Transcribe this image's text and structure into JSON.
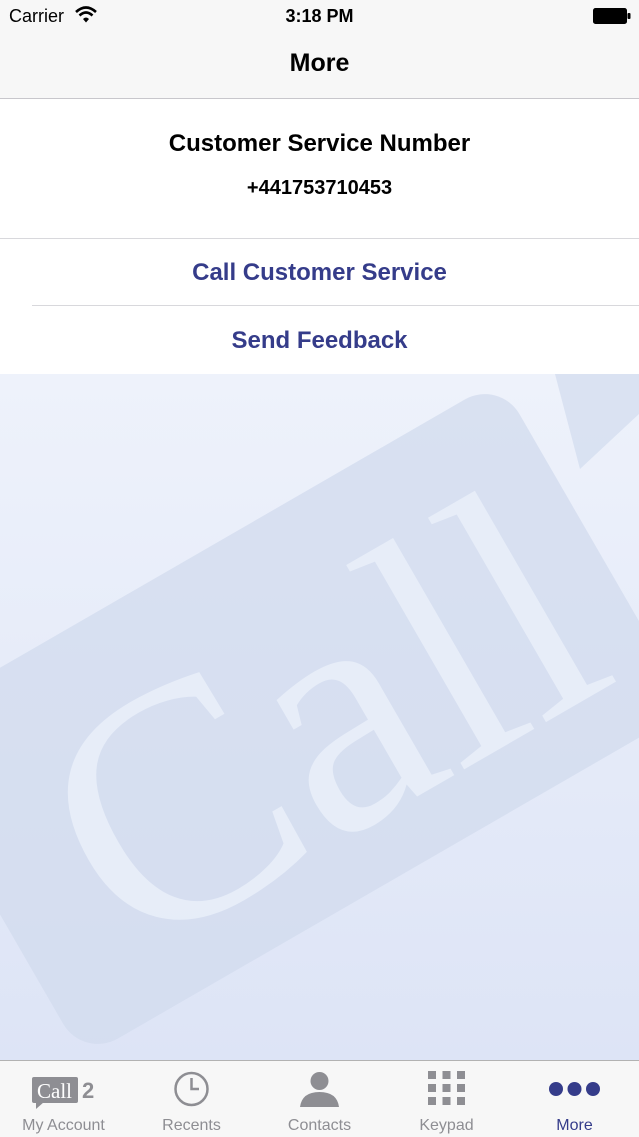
{
  "status_bar": {
    "carrier": "Carrier",
    "time": "3:18 PM",
    "icons": [
      "wifi-icon",
      "battery-icon"
    ]
  },
  "nav": {
    "title": "More"
  },
  "info": {
    "heading": "Customer Service Number",
    "number": "+441753710453"
  },
  "actions": {
    "call_label": "Call Customer Service",
    "feedback_label": "Send Feedback"
  },
  "watermark": {
    "text": "Call"
  },
  "tabs": [
    {
      "label": "My Account",
      "icon": "call2-logo-icon",
      "logo_text": "Call",
      "logo_number": "2",
      "active": false
    },
    {
      "label": "Recents",
      "icon": "clock-icon",
      "active": false
    },
    {
      "label": "Contacts",
      "icon": "person-icon",
      "active": false
    },
    {
      "label": "Keypad",
      "icon": "keypad-icon",
      "active": false
    },
    {
      "label": "More",
      "icon": "more-dots-icon",
      "active": true
    }
  ],
  "colors": {
    "accent": "#353c8a",
    "inactive_tab": "#8e8e93",
    "bar_background": "#f7f7f7"
  }
}
